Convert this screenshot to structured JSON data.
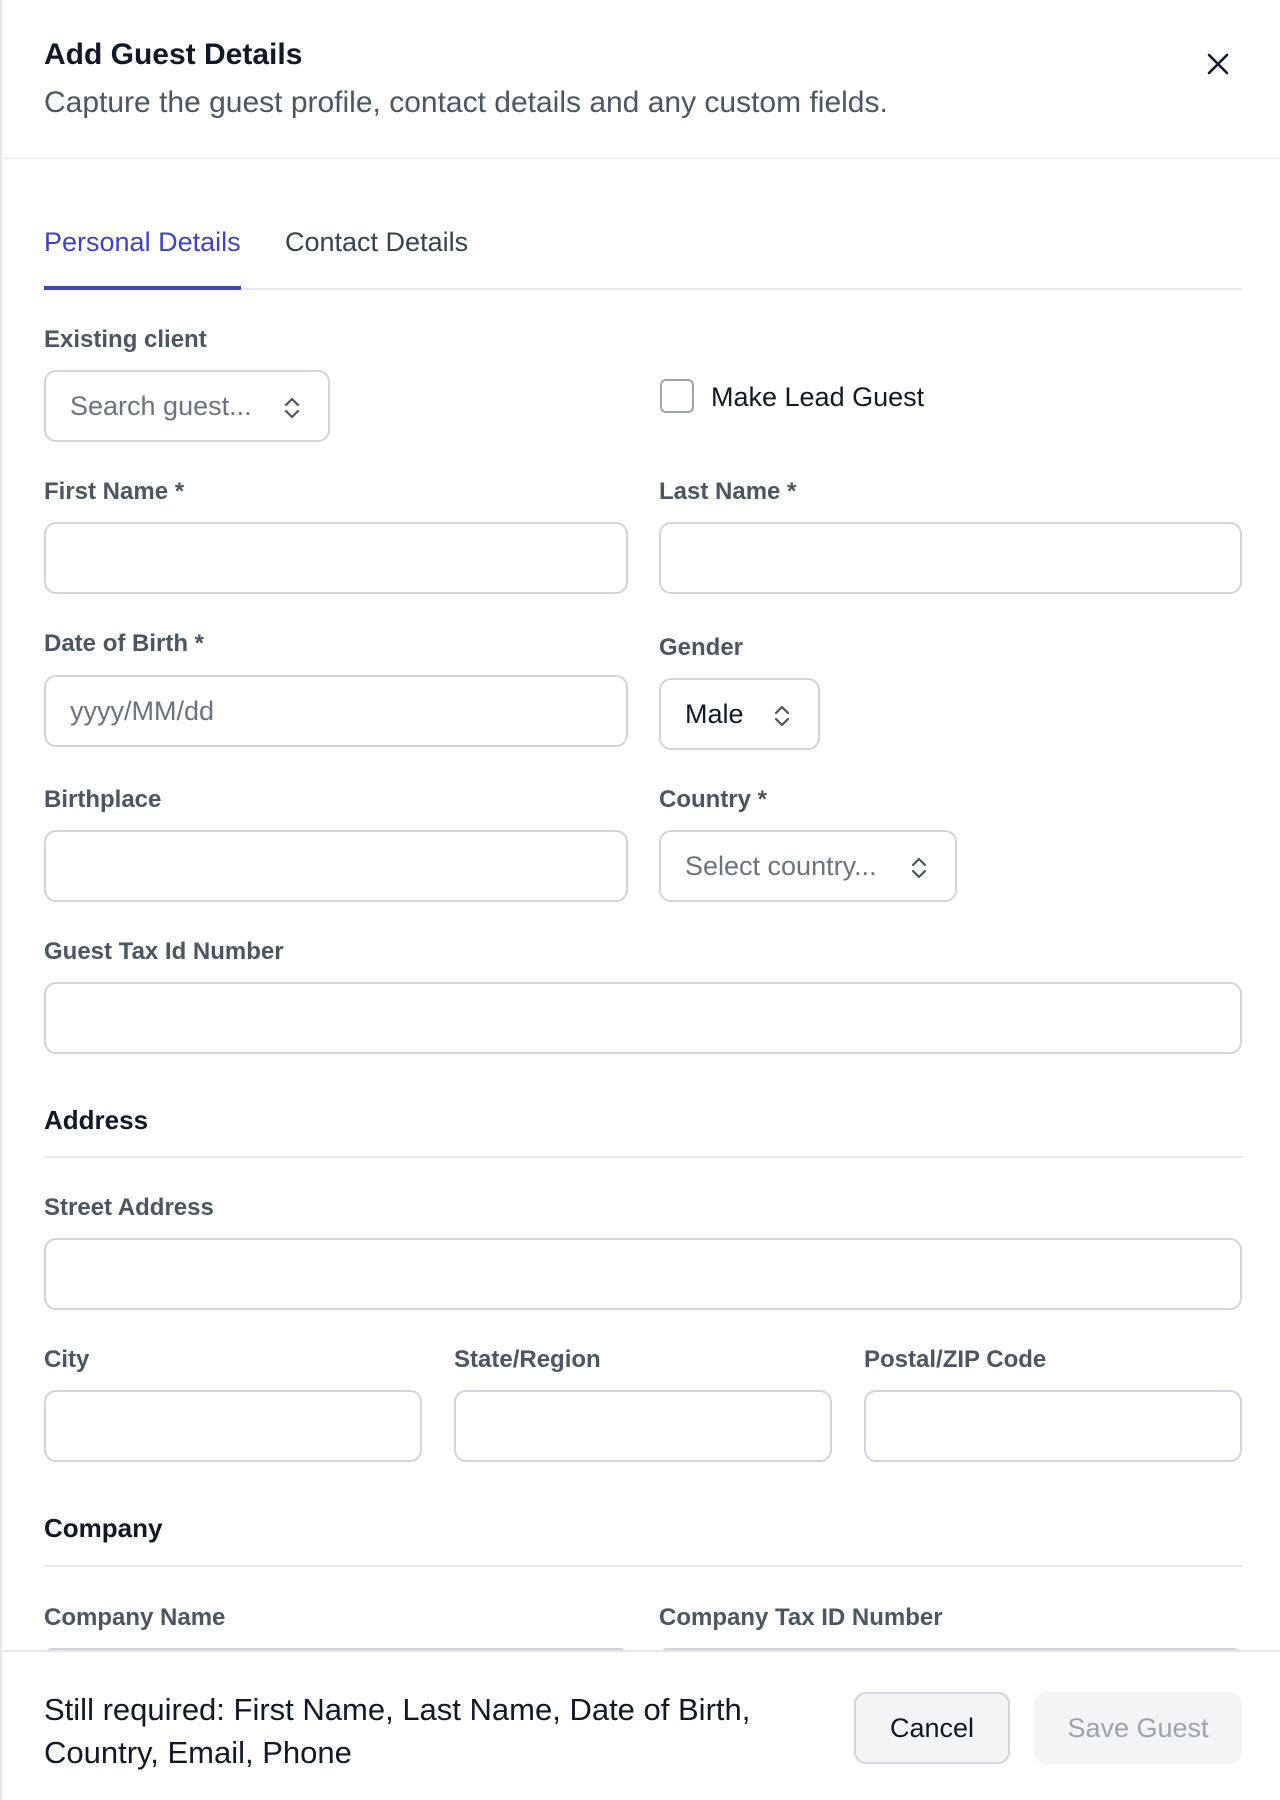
{
  "header": {
    "title": "Add Guest Details",
    "subtitle": "Capture the guest profile, contact details and any custom fields.",
    "close_icon": "close-icon"
  },
  "tabs": [
    {
      "label": "Personal Details",
      "active": true
    },
    {
      "label": "Contact Details",
      "active": false
    }
  ],
  "form": {
    "existing_client": {
      "label": "Existing client",
      "placeholder": "Search guest..."
    },
    "make_lead_guest": {
      "label": "Make Lead Guest",
      "checked": false
    },
    "first_name": {
      "label": "First Name *",
      "value": ""
    },
    "last_name": {
      "label": "Last Name *",
      "value": ""
    },
    "date_of_birth": {
      "label": "Date of Birth *",
      "placeholder": "yyyy/MM/dd"
    },
    "gender": {
      "label": "Gender",
      "value": "Male"
    },
    "birthplace": {
      "label": "Birthplace",
      "value": ""
    },
    "country": {
      "label": "Country *",
      "placeholder": "Select country..."
    },
    "guest_tax_id": {
      "label": "Guest Tax Id Number",
      "value": ""
    }
  },
  "address": {
    "section_title": "Address",
    "street": {
      "label": "Street Address",
      "value": ""
    },
    "city": {
      "label": "City",
      "value": ""
    },
    "state": {
      "label": "State/Region",
      "value": ""
    },
    "postal": {
      "label": "Postal/ZIP Code",
      "value": ""
    }
  },
  "company": {
    "section_title": "Company",
    "name": {
      "label": "Company Name"
    },
    "tax_id": {
      "label": "Company Tax ID Number"
    }
  },
  "footer": {
    "required_note": "Still required: First Name, Last Name, Date of Birth, Country, Email, Phone",
    "cancel_label": "Cancel",
    "save_label": "Save Guest"
  },
  "colors": {
    "accent": "#3b43c6",
    "border": "#d1d5db",
    "disabled_text": "#9ca3af"
  }
}
